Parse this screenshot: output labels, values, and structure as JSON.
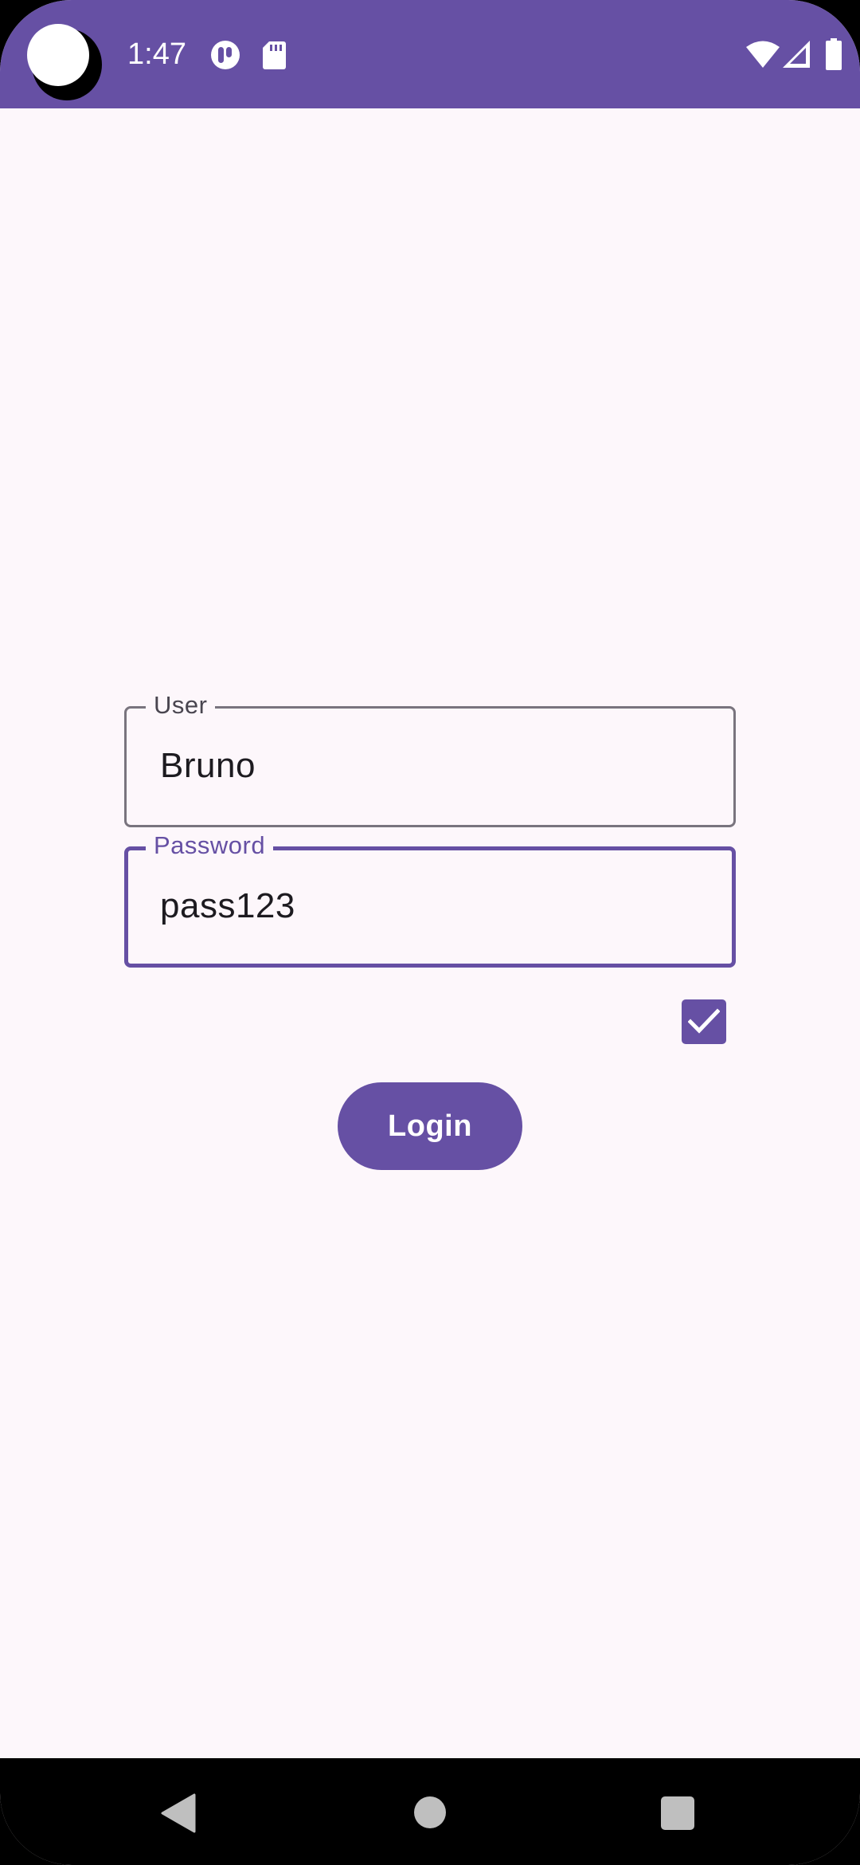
{
  "status_bar": {
    "time": "1:47",
    "icons": [
      "notification-app-icon",
      "sd-card-icon",
      "wifi-icon",
      "cell-signal-icon",
      "battery-icon"
    ],
    "background_color": "#6650a4"
  },
  "form": {
    "user": {
      "label": "User",
      "value": "Bruno"
    },
    "password": {
      "label": "Password",
      "value": "pass123",
      "focused": true
    },
    "checkbox": {
      "checked": true
    },
    "login_button": {
      "label": "Login"
    }
  },
  "theme": {
    "primary": "#6650a4",
    "background": "#fdf7fb",
    "outline": "#79747e",
    "on_surface": "#1d1b20"
  },
  "nav_bar": {
    "buttons": [
      "back-icon",
      "home-icon",
      "recents-icon"
    ]
  }
}
